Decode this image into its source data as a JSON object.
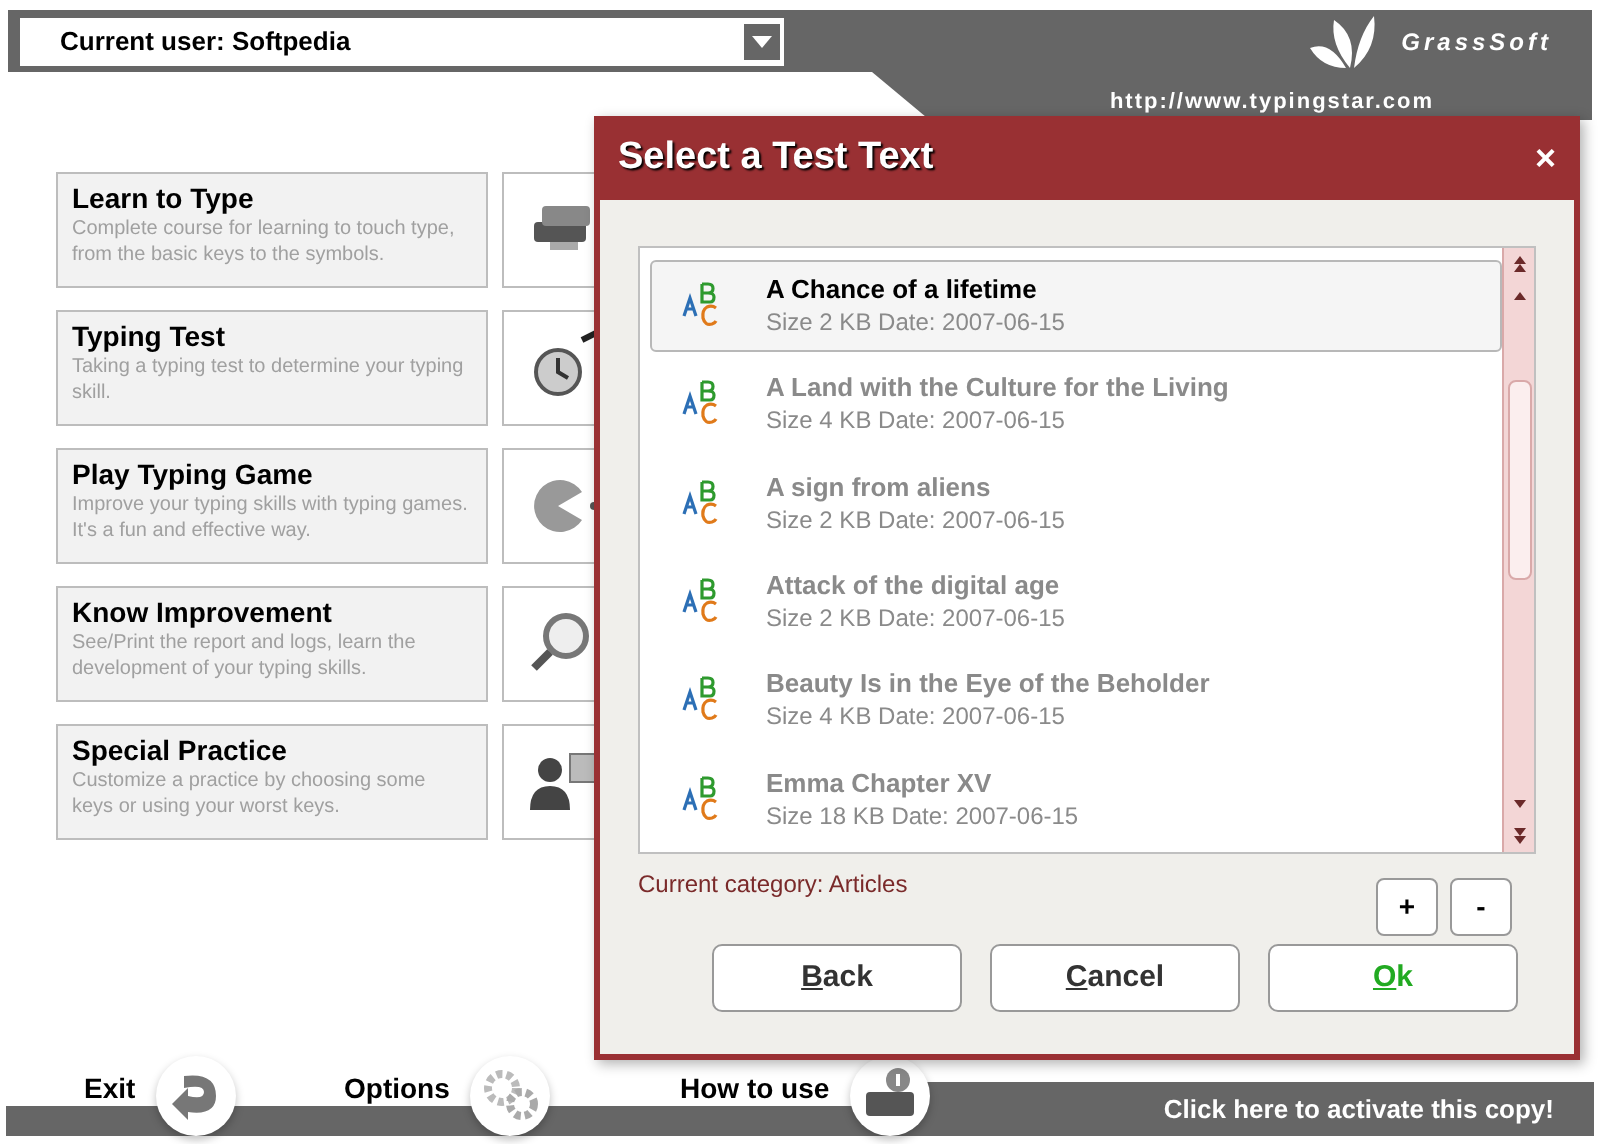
{
  "header": {
    "user_select": {
      "value": "Current user: Softpedia"
    },
    "brand": "GrassSoft",
    "url": "http://www.typingstar.com"
  },
  "menu": [
    {
      "title": "Learn to Type",
      "description": "Complete course for learning to touch type, from the basic keys to the symbols.",
      "kind": "books"
    },
    {
      "title": "Typing Test",
      "description": "Taking a typing test to determine your typing skill.",
      "kind": "clock"
    },
    {
      "title": "Play Typing Game",
      "description": "Improve your typing skills with typing games. It's a fun and effective way.",
      "kind": "game"
    },
    {
      "title": "Know Improvement",
      "description": "See/Print the report and logs, learn the development of your typing skills.",
      "kind": "magnifier"
    },
    {
      "title": "Special Practice",
      "description": "Customize a practice by choosing some keys or using your worst keys.",
      "kind": "user"
    }
  ],
  "footer": {
    "links": [
      {
        "label": "Exit",
        "kind": "exit"
      },
      {
        "label": "Options",
        "kind": "gears"
      },
      {
        "label": "How to use",
        "kind": "help"
      }
    ],
    "activate": "Click here to activate this copy!"
  },
  "dialog": {
    "title": "Select a Test Text",
    "close": "×",
    "texts": [
      {
        "title": "A Chance of a lifetime",
        "info": "Size 2 KB  Date: 2007-06-15",
        "selected": true
      },
      {
        "title": "A Land with the Culture for the Living",
        "info": "Size 4 KB  Date: 2007-06-15",
        "selected": false
      },
      {
        "title": "A sign from aliens",
        "info": "Size 2 KB  Date: 2007-06-15",
        "selected": false
      },
      {
        "title": "Attack of the digital age",
        "info": "Size 2 KB  Date: 2007-06-15",
        "selected": false
      },
      {
        "title": "Beauty Is in the Eye of the Beholder",
        "info": "Size 4 KB  Date: 2007-06-15",
        "selected": false
      },
      {
        "title": "Emma Chapter XV",
        "info": "Size 18 KB  Date: 2007-06-15",
        "selected": false
      }
    ],
    "category": "Current category: Articles",
    "small_buttons": [
      "+",
      "-"
    ],
    "buttons": [
      {
        "label": "Back",
        "kind": "normal"
      },
      {
        "label": "Cancel",
        "kind": "normal"
      },
      {
        "label": "Ok",
        "kind": "primary"
      }
    ]
  }
}
